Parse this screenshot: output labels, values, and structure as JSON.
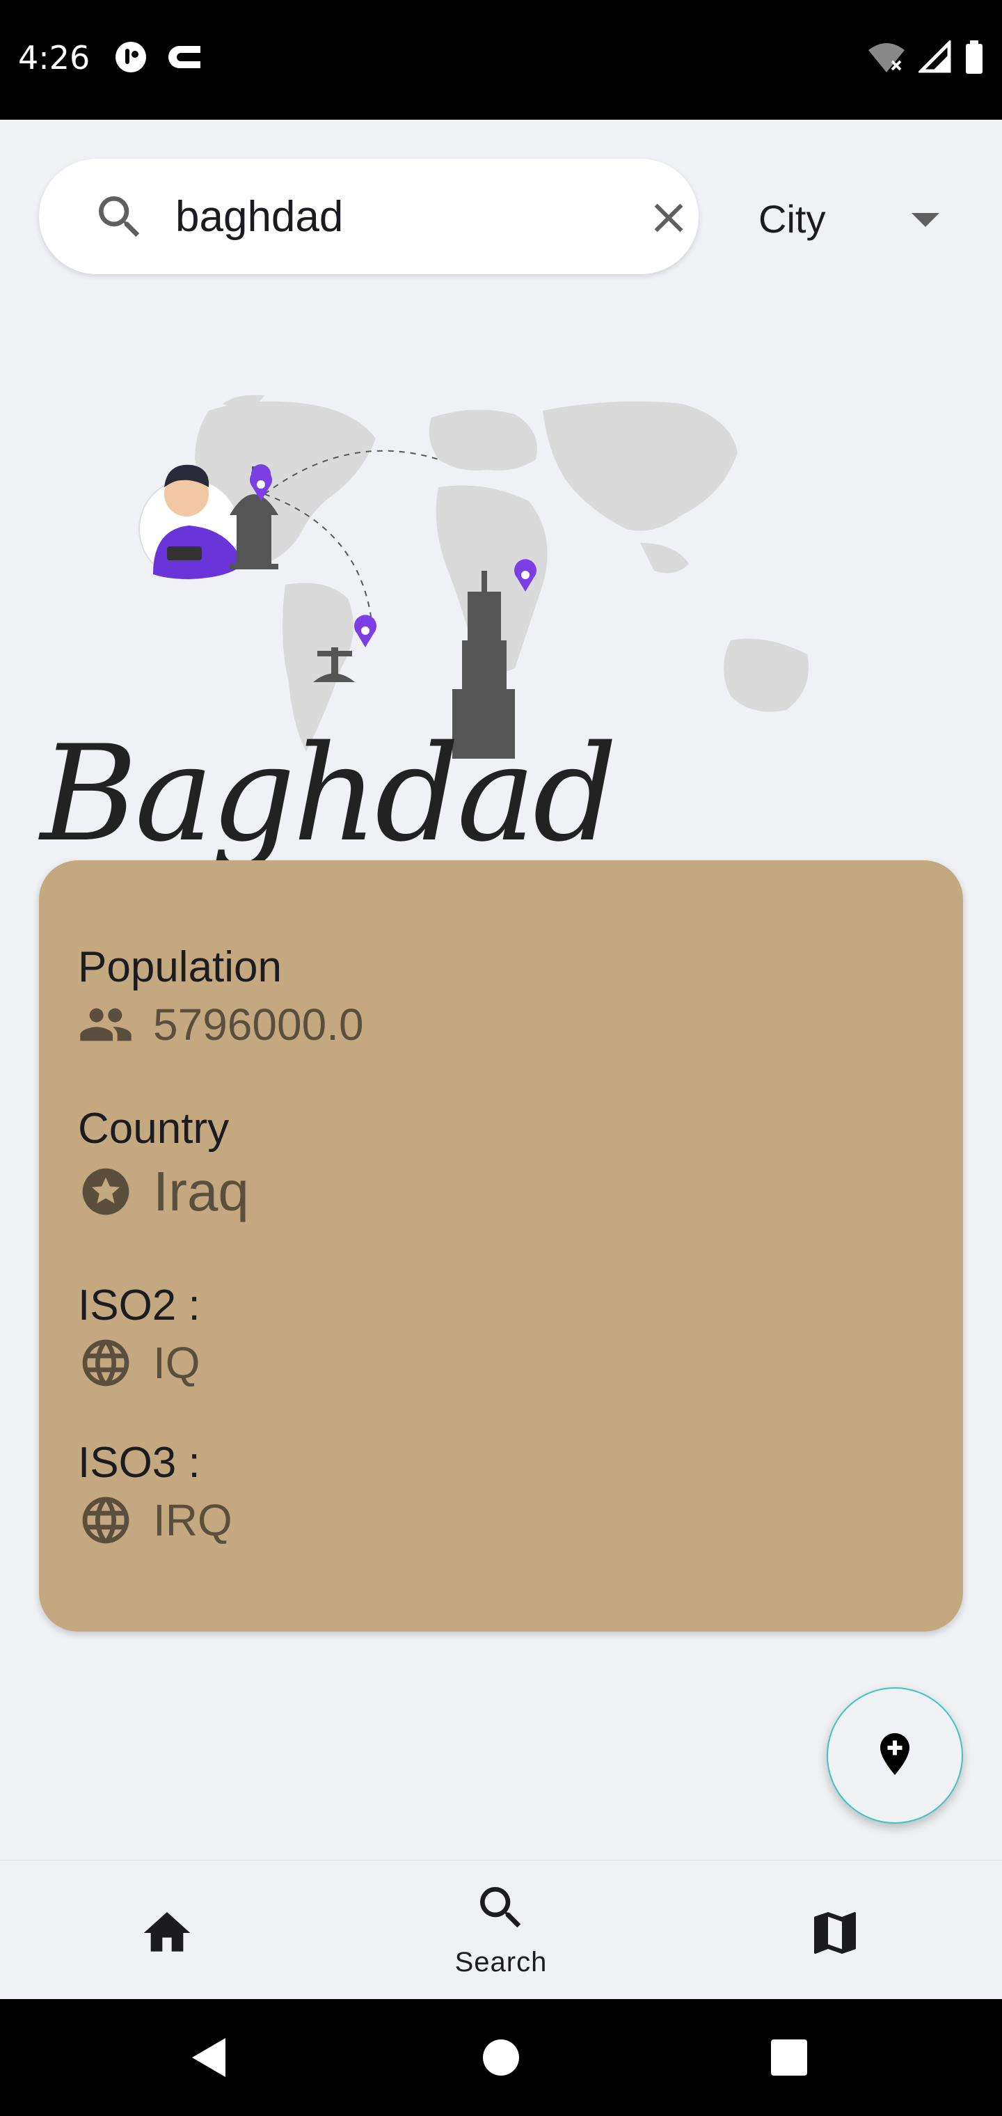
{
  "status_bar": {
    "time": "4:26"
  },
  "search": {
    "value": "baghdad",
    "filter_selected": "City"
  },
  "city": {
    "name": "Baghdad"
  },
  "details": {
    "population_label": "Population",
    "population_value": "5796000.0",
    "country_label": "Country",
    "country_value": "Iraq",
    "iso2_label": "ISO2 :",
    "iso2_value": "IQ",
    "iso3_label": "ISO3 :",
    "iso3_value": "IRQ"
  },
  "nav": {
    "items": [
      {
        "icon": "home-icon",
        "label": ""
      },
      {
        "icon": "search-icon",
        "label": "Search"
      },
      {
        "icon": "map-icon",
        "label": ""
      }
    ]
  },
  "colors": {
    "card": "#c4a880",
    "background": "#f0f1f5",
    "accent": "#3cc7b8",
    "pin": "#7b3fe4"
  }
}
